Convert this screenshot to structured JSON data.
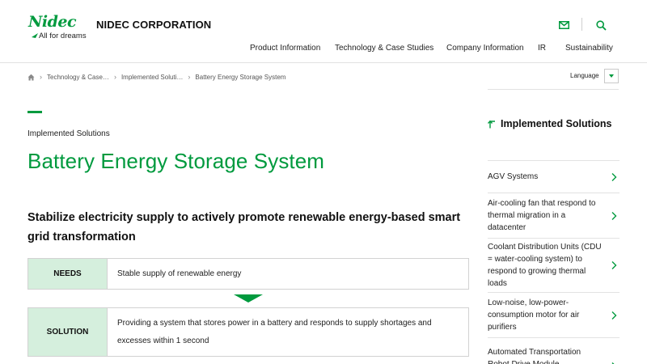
{
  "header": {
    "logo_mark": "Nidec",
    "logo_tagline": "All for dreams",
    "corporation": "NIDEC CORPORATION",
    "icons": {
      "mail": "mail-icon",
      "search": "search-icon"
    },
    "nav": [
      "Product Information",
      "Technology & Case Studies",
      "Company Information",
      "IR",
      "Sustainability"
    ]
  },
  "breadcrumb": {
    "home_icon": "home-icon",
    "items": [
      "Technology & Case…",
      "Implemented Soluti…",
      "Battery Energy Storage System"
    ]
  },
  "language": {
    "label": "Language"
  },
  "main": {
    "eyebrow": "Implemented Solutions",
    "title": "Battery Energy Storage System",
    "lead": "Stabilize electricity supply to actively promote renewable energy-based smart grid transformation",
    "needs": {
      "label": "NEEDS",
      "text": "Stable supply of renewable energy"
    },
    "solution": {
      "label": "SOLUTION",
      "text": "Providing a system that stores power in a battery and responds to supply shortages and excesses within 1 second"
    }
  },
  "sidebar": {
    "title": "Implemented Solutions",
    "items": [
      {
        "label": "AGV Systems"
      },
      {
        "label": "Air-cooling fan that respond to thermal migration in a datacenter"
      },
      {
        "label": "Coolant Distribution Units (CDU = water-cooling system) to respond to growing thermal loads"
      },
      {
        "label": "Low-noise, low-power-consumption motor for air purifiers"
      },
      {
        "label": "Automated Transportation Robot Drive Module"
      }
    ]
  },
  "colors": {
    "brand_green": "#009a3e",
    "label_bg": "#d5efdd",
    "border": "#d2d2d2"
  }
}
